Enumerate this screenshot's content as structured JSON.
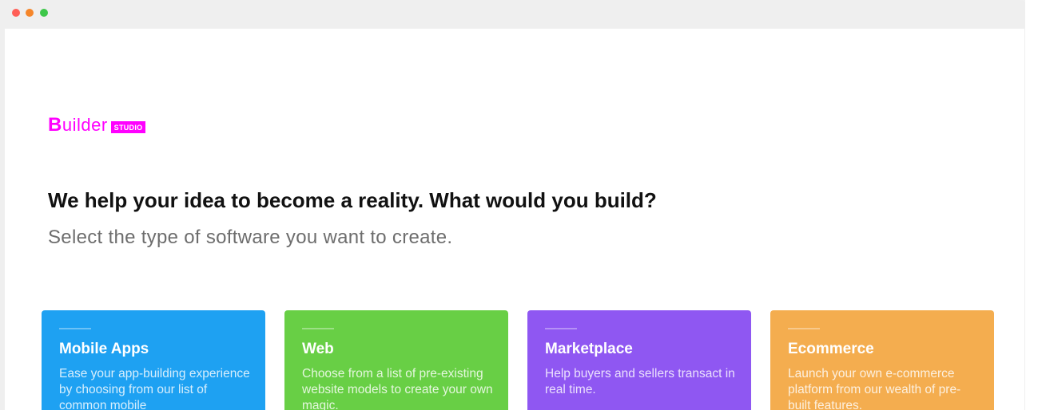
{
  "window": {
    "controls": [
      "close",
      "minimize",
      "maximize"
    ]
  },
  "logo": {
    "first_letter": "B",
    "rest": "uilder",
    "badge": "STUDIO",
    "color": "#ff00ff"
  },
  "hero": {
    "headline": "We help your idea to become a reality. What would you build?",
    "subhead": "Select the type of software you want to create."
  },
  "cards": [
    {
      "title": "Mobile Apps",
      "description": "Ease your app-building experience by choosing from our list of common mobile",
      "color": "#1ea1f2"
    },
    {
      "title": "Web",
      "description": "Choose from a list of pre-existing website models to create your own magic.",
      "color": "#68cf45"
    },
    {
      "title": "Marketplace",
      "description": "Help buyers and sellers transact in real time.",
      "color": "#8f57f2"
    },
    {
      "title": "Ecommerce",
      "description": "Launch your own e-commerce platform from our wealth of pre-built features.",
      "color": "#f4ad4f"
    }
  ]
}
